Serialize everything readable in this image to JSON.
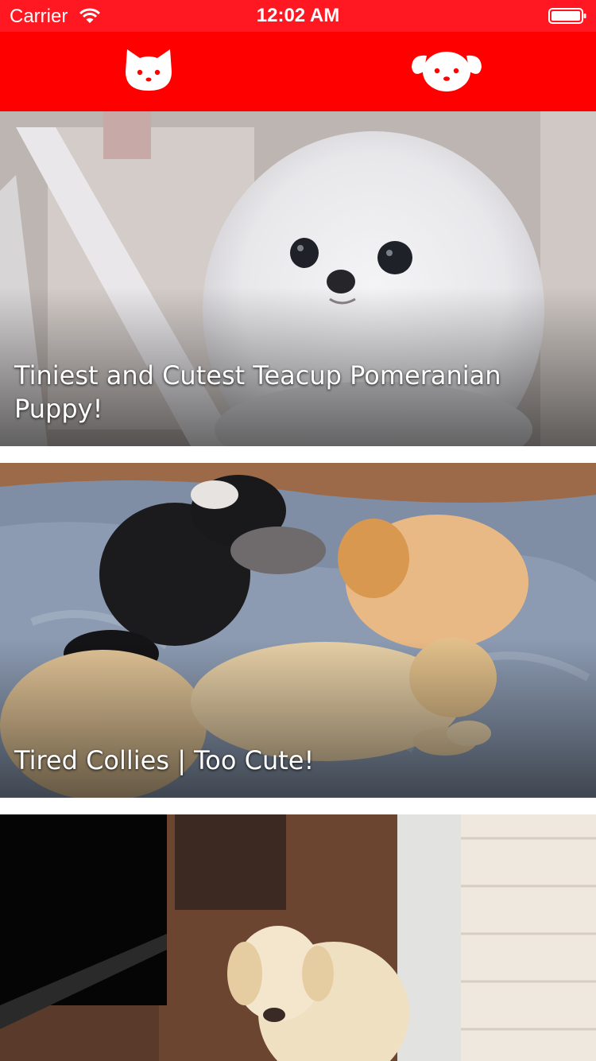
{
  "status_bar": {
    "carrier": "Carrier",
    "time": "12:02 AM"
  },
  "tabs": [
    {
      "icon": "cat-face-icon",
      "selected": false
    },
    {
      "icon": "dog-face-icon",
      "selected": true
    }
  ],
  "colors": {
    "accent": "#ff0000",
    "status_bar": "#ff1721",
    "tab_icon": "#ffffff"
  },
  "videos": [
    {
      "title": "Tiniest and Cutest Teacup Pomeranian Puppy!"
    },
    {
      "title": "Tired Collies | Too Cute!"
    },
    {
      "title": ""
    }
  ]
}
